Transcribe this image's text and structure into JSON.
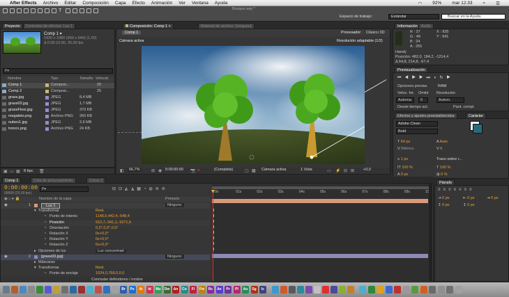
{
  "menubar": {
    "apple": "",
    "app": "After Effects",
    "items": [
      "Archivo",
      "Editar",
      "Composición",
      "Capa",
      "Efecto",
      "Animación",
      "Ver",
      "Ventana",
      "Ayuda"
    ],
    "battery": "92%",
    "clock": "mar 12:33"
  },
  "toolbar": {
    "file_title": "Bosque.aep *",
    "workspace_label": "Espacio de trabajo:",
    "workspace_value": "Estándar",
    "search_placeholder": "Buscar en la Ayuda"
  },
  "project": {
    "tab": "Proyecto",
    "tab2": "Controles de efectos: Luz 1",
    "comp_name": "Comp 1 ▾",
    "comp_info1": "1920 x 1080 (960 x 540) (1,00)",
    "comp_info2": "Δ 0:00:10:00, 25,00 fps",
    "search_placeholder": "Ρ▾",
    "columns": [
      "Nombre",
      "Tipo",
      "Tamaño",
      "Velocid."
    ],
    "items": [
      {
        "name": "Comp 1",
        "type": "Composi...",
        "size": "",
        "rate": "25",
        "color": "#c8b870"
      },
      {
        "name": "Comp 2",
        "type": "Composi...",
        "size": "",
        "rate": "25",
        "color": "#c8b870"
      },
      {
        "name": "grass.jpg",
        "type": "JPEG",
        "size": "8,4 MB",
        "rate": "",
        "color": "#9a8ad0"
      },
      {
        "name": "grass03.jpg",
        "type": "JPEG",
        "size": "1,7 MB",
        "rate": "",
        "color": "#9a8ad0"
      },
      {
        "name": "grassFloor.jpg",
        "type": "JPEG",
        "size": "370 KB",
        "rate": "",
        "color": "#9a8ad0"
      },
      {
        "name": "megaleto.png",
        "type": "Archivo PNG",
        "size": "260 KB",
        "rate": "",
        "color": "#9a8ad0"
      },
      {
        "name": "nubes1.jpg",
        "type": "JPEG",
        "size": "2,6 MB",
        "rate": "",
        "color": "#9a8ad0"
      },
      {
        "name": "tronco.png",
        "type": "Archivo PNG",
        "size": "24 KB",
        "rate": "",
        "color": "#9a8ad0"
      }
    ],
    "footer_bpc": "8 bpc"
  },
  "comp": {
    "tab": "Composición: Comp 1",
    "tab2": "Material de archivo: (ninguno)",
    "subtab": "Comp 1",
    "renderer_label": "Procesador:",
    "renderer_value": "Clásico 3D",
    "camera_label": "Cámara activa",
    "resolution_label": "Resolución adaptable (1/2)",
    "zoom": "66,7%",
    "timecode": "0:00:00:00",
    "quality": "(Completa)",
    "view": "Cámara activa",
    "views": "1 Vista",
    "offset": "+0,0"
  },
  "info": {
    "tab": "Información",
    "tab2": "Audio",
    "r": "R : 37",
    "g": "G : 49",
    "b": "B : 24",
    "a": "A : 255",
    "x": "X : 935",
    "y": "Y : 941",
    "layer": "Handy",
    "pos": "Posición: 482,0, 184,2, -1214,4",
    "delta": "Δ 64,8, 214,8, -67,4"
  },
  "preview": {
    "tab": "Previsualización",
    "options_label": "Opciones previas",
    "options_value": "RAM",
    "fps_label": "Veloc. fot.",
    "skip_label": "Omitir",
    "res_label": "Resolución",
    "fps_value": "Automa",
    "skip_value": "0",
    "res_value": "Autom.",
    "from_current": "Desde tiempo act.",
    "fullscreen": "Pant. compl."
  },
  "effects": {
    "tab": "Efectos y ajustes preestablecidos",
    "search_placeholder": "Ρ▾"
  },
  "character": {
    "tab": "Carácter",
    "font": "Adobe Clean",
    "style": "Bold",
    "size": "64 px",
    "leading": "Auto",
    "kerning": "Métrica",
    "tracking": "0",
    "stroke": "1 px",
    "stroke_mode": "Trazo sobre r...",
    "vscale": "100 %",
    "hscale": "100 %",
    "baseline": "0 px",
    "tsume": "0 %"
  },
  "paragraph": {
    "tab": "Párrafo",
    "indent1": "0 px",
    "indent2": "0 px",
    "indent3": "0 px",
    "space1": "0 px",
    "space2": "0 px"
  },
  "timeline": {
    "tabs": [
      "Comp 1",
      "Cola de procesamiento",
      "Comp 2"
    ],
    "timecode": "0:00:00:00",
    "frames": "00000 (25.00 fps)",
    "search_placeholder": "Ρ▾",
    "col_layer": "Nombre de la capa",
    "col_parent": "Primario",
    "ruler": [
      "0s",
      "01s",
      "02s",
      "03s",
      "04s",
      "05s",
      "06s",
      "07s",
      "08s",
      "09s",
      "10s"
    ],
    "layers": [
      {
        "num": "1",
        "name": "Luz 1",
        "parent": "Ninguno"
      },
      {
        "num": "2",
        "name": "[grass03.jpg]",
        "parent": "Ninguno"
      }
    ],
    "transform": "Transformar",
    "reset": "Rest.",
    "props": [
      {
        "name": "Punto de interés",
        "value": "1148,0,442,4,-548,4"
      },
      {
        "name": "Posición",
        "value": "910,7,-341,1,-1671,6"
      },
      {
        "name": "Orientación",
        "value": "0,0°,0,0°,0,0°"
      },
      {
        "name": "Rotación X",
        "value": "0x+0,0°"
      },
      {
        "name": "Rotación Y",
        "value": "0x+0,0°"
      },
      {
        "name": "Rotación Z",
        "value": "0x+0,0°"
      }
    ],
    "light_options": "Opciones de luz",
    "light_type": "Luz concentrad",
    "masks": "Máscaras",
    "transform2": "Transformar",
    "reset2": "Rest.",
    "anchor_label": "Punto de anclaje",
    "anchor_value": "1024,0,768,0,0,0",
    "footer": "Conmutar definidores / modos"
  },
  "dock": [
    "Br",
    "Ps",
    "Ai",
    "Id",
    "Mu",
    "Dw",
    "An",
    "Co",
    "Fl",
    "Fw",
    "Rc",
    "Ae",
    "Pr",
    "Pl",
    "Au",
    "Sg",
    "Ic"
  ]
}
